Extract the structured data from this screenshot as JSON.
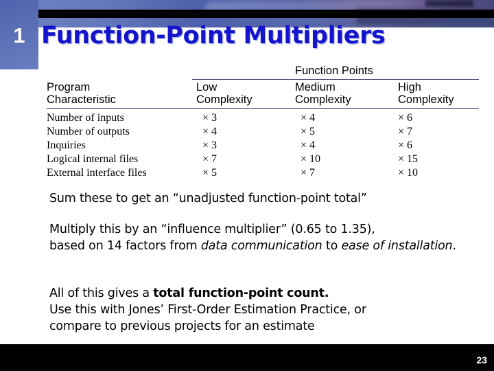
{
  "slide": {
    "number": "1",
    "title": "Function-Point Multipliers",
    "page_number": "23",
    "title_color": "#1414CC",
    "panel_color": "#5A6FB6"
  },
  "table": {
    "group_header": "Function Points",
    "row_header_line1": "Program",
    "row_header_line2": "Characteristic",
    "columns": [
      {
        "line1": "Low",
        "line2": "Complexity"
      },
      {
        "line1": "Medium",
        "line2": "Complexity"
      },
      {
        "line1": "High",
        "line2": "Complexity"
      }
    ],
    "rows": [
      {
        "characteristic": "Number of inputs",
        "low": "× 3",
        "medium": "× 4",
        "high": "× 6"
      },
      {
        "characteristic": "Number of outputs",
        "low": "× 4",
        "medium": "× 5",
        "high": "× 7"
      },
      {
        "characteristic": "Inquiries",
        "low": "× 3",
        "medium": "× 4",
        "high": "× 6"
      },
      {
        "characteristic": "Logical internal files",
        "low": "× 7",
        "medium": "× 10",
        "high": "× 15"
      },
      {
        "characteristic": "External interface files",
        "low": "× 5",
        "medium": "× 7",
        "high": "× 10"
      }
    ]
  },
  "body": {
    "para_sum": "Sum these to get an “unadjusted function-point total”",
    "para_multiply_a": "Multiply this by an “influence multiplier” (0.65 to 1.35),",
    "para_multiply_b": "based on 14 factors from ",
    "para_multiply_ital1": "data communication",
    "para_multiply_c": " to ",
    "para_multiply_ital2": "ease of installation",
    "para_multiply_d": ".",
    "para_total_a": "All of this gives a ",
    "para_total_bold": "total function-point count.",
    "para_total_b": "Use this with Jones’ First-Order Estimation Practice, or",
    "para_total_c": "compare to previous projects for an estimate"
  }
}
